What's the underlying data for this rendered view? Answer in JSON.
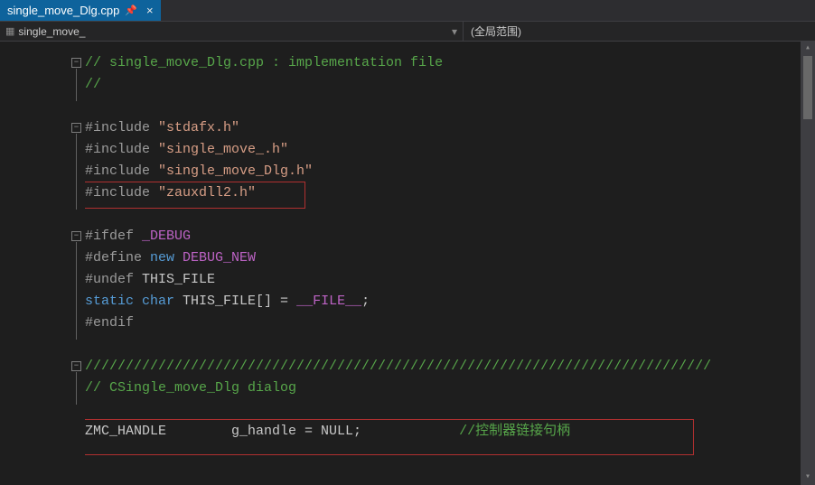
{
  "tab": {
    "filename": "single_move_Dlg.cpp",
    "pinned": true
  },
  "nav": {
    "context": "single_move_",
    "scope": "(全局范围)"
  },
  "code": {
    "l1_a": "// single_move_Dlg.cpp : implementation file",
    "l2_a": "//",
    "l4_inc": "#include ",
    "l4_s": "\"stdafx.h\"",
    "l5_inc": "#include ",
    "l5_s": "\"single_move_.h\"",
    "l6_inc": "#include ",
    "l6_s": "\"single_move_Dlg.h\"",
    "l7_inc": "#include ",
    "l7_s": "\"zauxdll2.h\"",
    "l9_a": "#ifdef ",
    "l9_b": "_DEBUG",
    "l10_a": "#define ",
    "l10_b": "new",
    "l10_c": " DEBUG_NEW",
    "l11_a": "#undef ",
    "l11_b": "THIS_FILE",
    "l12_a": "static",
    "l12_b": " char",
    "l12_c": " THIS_FILE[] = ",
    "l12_d": "__FILE__",
    "l12_e": ";",
    "l13_a": "#endif",
    "l15_a": "/////////////////////////////////////////////////////////////////////////////",
    "l16_a": "// CSingle_move_Dlg dialog",
    "l18_a": "ZMC_HANDLE        g_handle = NULL;            ",
    "l18_b": "//控制器链接句柄"
  }
}
